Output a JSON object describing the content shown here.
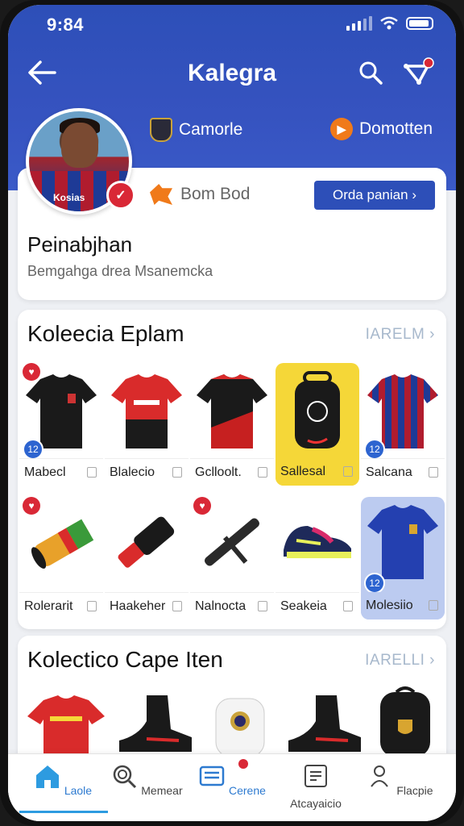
{
  "status_bar": {
    "time": "9:84"
  },
  "header": {
    "title": "Kalegra"
  },
  "header_actions": {
    "left_label": "Camorle",
    "right_label": "Domotten"
  },
  "profile": {
    "shirt_text": "Kosias",
    "secondary_label": "Bom Bod",
    "order_button": "Orda panian",
    "name": "Peinabjhan",
    "subtitle": "Bemgahga drea Msanemcka"
  },
  "section1": {
    "title": "Koleecia Eplam",
    "link": "IARELM",
    "items": [
      {
        "label": "Mabecl"
      },
      {
        "label": "Blalecio"
      },
      {
        "label": "Gclloolt."
      },
      {
        "label": "Sallesal"
      },
      {
        "label": "Salcana"
      },
      {
        "label": "Rolerarit"
      },
      {
        "label": "Haakeher"
      },
      {
        "label": "Nalnocta"
      },
      {
        "label": "Seakeia"
      },
      {
        "label": "Molesiio"
      }
    ],
    "badge_number": "12"
  },
  "section2": {
    "title": "Kolectico Cape Iten",
    "link": "IARELLI"
  },
  "tabbar": {
    "tabs": [
      {
        "label": "Laole"
      },
      {
        "label": "Memear"
      },
      {
        "label": "Cerene"
      },
      {
        "label": "Atcayaicio"
      },
      {
        "label": "Flacpie"
      }
    ]
  },
  "colors": {
    "brand": "#2d4fb8",
    "accent_red": "#d92836",
    "highlight_yellow": "#f5d738",
    "highlight_blue": "#bccbf0"
  }
}
